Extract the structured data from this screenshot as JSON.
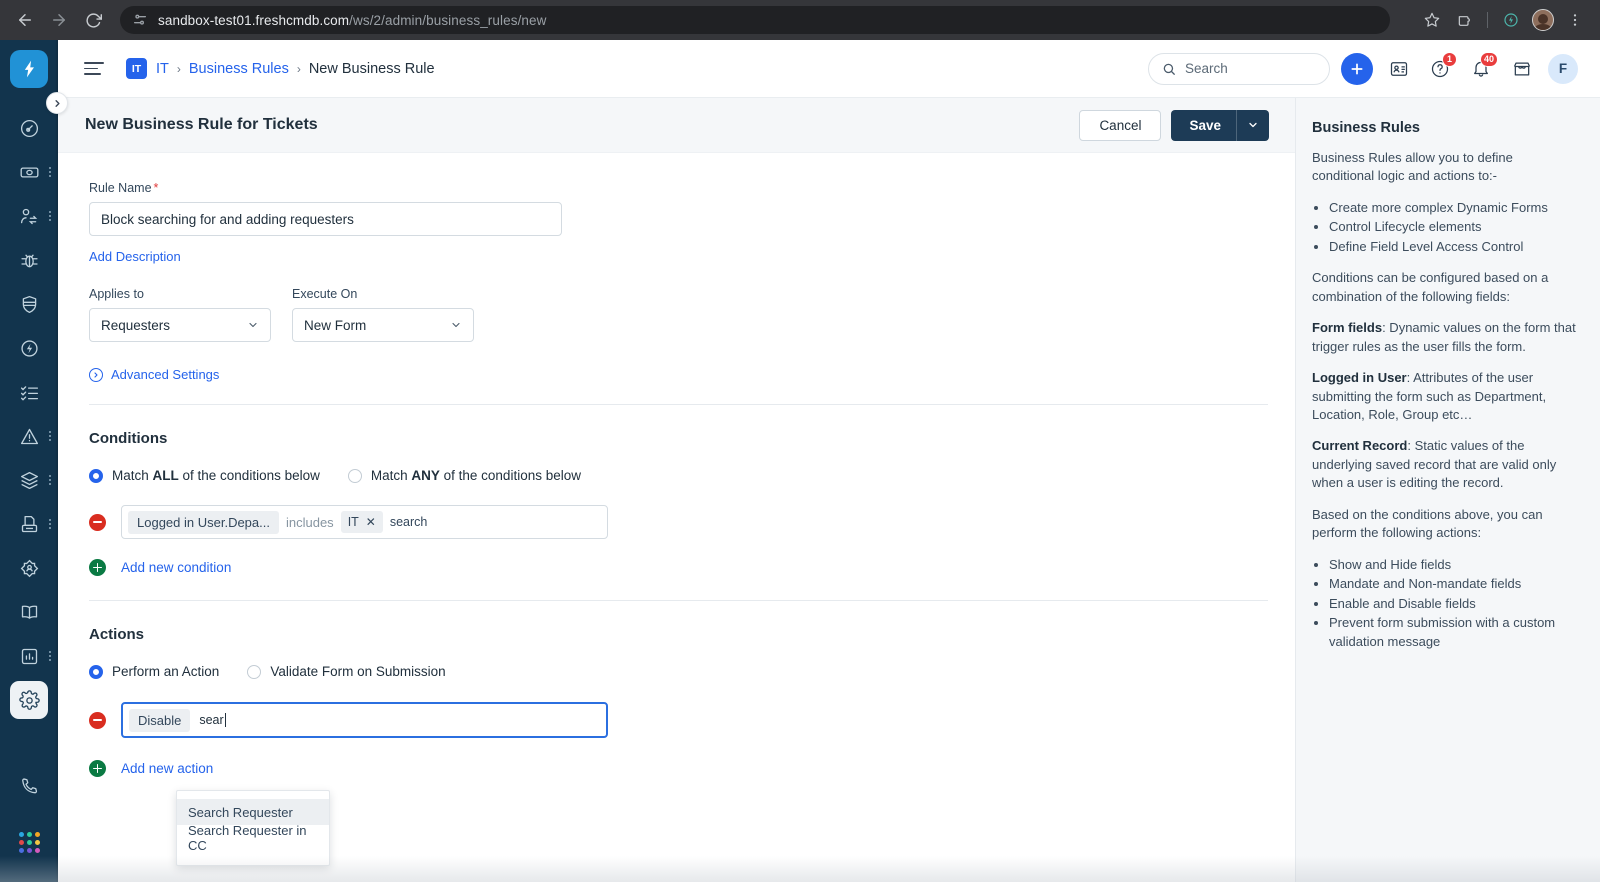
{
  "browser": {
    "url_bold": "sandbox-test01.freshcmdb.com",
    "url_dim": "/ws/2/admin/business_rules/new",
    "icons": [
      "back-icon",
      "forward-icon",
      "reload-icon",
      "site-settings-icon",
      "bookmark-star-icon",
      "extensions-icon",
      "freshworks-extension-icon",
      "profile-avatar",
      "browser-menu-icon"
    ]
  },
  "leftnav": {
    "brand": "freshworks-logo",
    "items": [
      {
        "name": "dashboard-icon",
        "has_dots": false
      },
      {
        "name": "tickets-icon",
        "has_dots": true
      },
      {
        "name": "user-transfer-icon",
        "has_dots": true
      },
      {
        "name": "bug-icon",
        "has_dots": false
      },
      {
        "name": "shield-icon",
        "has_dots": false
      },
      {
        "name": "energy-circle-icon",
        "has_dots": false
      },
      {
        "name": "checklist-icon",
        "has_dots": false
      },
      {
        "name": "alert-triangle-icon",
        "has_dots": true
      },
      {
        "name": "layers-icon",
        "has_dots": true
      },
      {
        "name": "archive-icon",
        "has_dots": true
      },
      {
        "name": "contact-target-icon",
        "has_dots": false
      },
      {
        "name": "knowledge-book-icon",
        "has_dots": false
      },
      {
        "name": "analytics-icon",
        "has_dots": true
      },
      {
        "name": "settings-gear-icon",
        "has_dots": false,
        "active": true
      }
    ],
    "bottom": [
      "phone-icon",
      "apps-grid-icon"
    ],
    "collapse_label": "expand-sidebar"
  },
  "header": {
    "workspace_badge": "IT",
    "breadcrumb": [
      {
        "label": "IT",
        "type": "link"
      },
      {
        "label": "Business Rules",
        "type": "link"
      },
      {
        "label": "New Business Rule",
        "type": "current"
      }
    ],
    "separator": "›",
    "search_placeholder": "Search",
    "help_badge": "1",
    "notification_badge": "40",
    "avatar_initial": "F"
  },
  "page": {
    "title": "New Business Rule for Tickets",
    "cancel_label": "Cancel",
    "save_label": "Save"
  },
  "form": {
    "rule_name_label": "Rule Name",
    "rule_name_value": "Block searching for and adding requesters",
    "add_description_label": "Add Description",
    "applies_to_label": "Applies to",
    "applies_to_value": "Requesters",
    "execute_on_label": "Execute On",
    "execute_on_value": "New Form",
    "advanced_settings_label": "Advanced Settings"
  },
  "conditions": {
    "title": "Conditions",
    "match_all_pre": "Match ",
    "match_all_bold": "ALL",
    "match_all_post": " of the conditions below",
    "match_any_pre": "Match ",
    "match_any_bold": "ANY",
    "match_any_post": " of the conditions below",
    "row": {
      "field_chip": "Logged in User.Depa...",
      "operator": "includes",
      "value_chip": "IT",
      "value_chip_remove": "✕",
      "typed_text": "search"
    },
    "add_label": "Add new condition"
  },
  "actions": {
    "title": "Actions",
    "perform_label": "Perform an Action",
    "validate_label": "Validate Form on Submission",
    "row": {
      "action_chip": "Disable",
      "typed_text": "sear"
    },
    "add_label": "Add new action",
    "dropdown_options": [
      {
        "label": "Search Requester",
        "selected": true
      },
      {
        "label": "Search Requester in CC",
        "selected": false
      }
    ]
  },
  "rightpanel": {
    "title": "Business Rules",
    "intro": "Business Rules allow you to define conditional logic and actions to:-",
    "list1": [
      "Create more complex Dynamic Forms",
      "Control Lifecycle elements",
      "Define Field Level Access Control"
    ],
    "conditions_note": "Conditions can be configured based on a combination of the following fields:",
    "form_fields_label": "Form fields",
    "form_fields_text": ": Dynamic values on the form that trigger rules as the user fills the form.",
    "logged_in_label": "Logged in User",
    "logged_in_text": ": Attributes of the user submitting the form such as Department, Location, Role, Group etc…",
    "current_record_label": "Current Record",
    "current_record_text": ": Static values of the underlying saved record that are valid only when a user is editing the record.",
    "actions_note": "Based on the conditions above, you can perform the following actions:",
    "list2": [
      "Show and Hide fields",
      "Mandate and Non-mandate fields",
      "Enable and Disable fields",
      "Prevent form submission with a custom validation message"
    ]
  },
  "colors": {
    "brand_blue": "#2563eb",
    "nav_bg": "#12344d",
    "save_navy": "#1d3b56",
    "danger_red": "#d92d20",
    "success_green": "#0a7a43",
    "focus_blue": "#2b6fe0"
  }
}
